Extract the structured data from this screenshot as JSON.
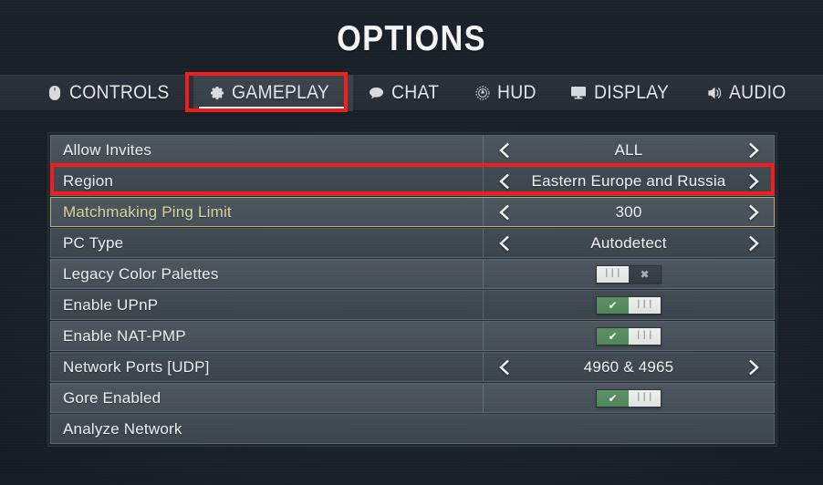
{
  "header": {
    "title": "OPTIONS"
  },
  "tabs": [
    {
      "id": "controls",
      "label": "CONTROLS",
      "icon": "mouse-icon",
      "active": false
    },
    {
      "id": "gameplay",
      "label": "GAMEPLAY",
      "icon": "gear-icon",
      "active": true
    },
    {
      "id": "chat",
      "label": "CHAT",
      "icon": "speech-bubble-icon",
      "active": false
    },
    {
      "id": "hud",
      "label": "HUD",
      "icon": "compass-icon",
      "active": false
    },
    {
      "id": "display",
      "label": "DISPLAY",
      "icon": "monitor-icon",
      "active": false
    },
    {
      "id": "audio",
      "label": "AUDIO",
      "icon": "speaker-icon",
      "active": false
    }
  ],
  "settings": [
    {
      "id": "allow-invites",
      "label": "Allow Invites",
      "type": "selector",
      "value": "ALL",
      "highlighted": false
    },
    {
      "id": "region",
      "label": "Region",
      "type": "selector",
      "value": "Eastern Europe and Russia",
      "highlighted": false
    },
    {
      "id": "matchmaking-ping-limit",
      "label": "Matchmaking Ping Limit",
      "type": "selector",
      "value": "300",
      "highlighted": true
    },
    {
      "id": "pc-type",
      "label": "PC Type",
      "type": "selector",
      "value": "Autodetect",
      "highlighted": false
    },
    {
      "id": "legacy-color-palettes",
      "label": "Legacy Color Palettes",
      "type": "toggle",
      "value": "off",
      "highlighted": false
    },
    {
      "id": "enable-upnp",
      "label": "Enable UPnP",
      "type": "toggle",
      "value": "on",
      "highlighted": false
    },
    {
      "id": "enable-nat-pmp",
      "label": "Enable NAT-PMP",
      "type": "toggle",
      "value": "on",
      "highlighted": false
    },
    {
      "id": "network-ports-udp",
      "label": "Network Ports [UDP]",
      "type": "selector",
      "value": "4960 & 4965",
      "highlighted": false
    },
    {
      "id": "gore-enabled",
      "label": "Gore Enabled",
      "type": "toggle",
      "value": "on",
      "highlighted": false
    },
    {
      "id": "analyze-network",
      "label": "Analyze Network",
      "type": "action",
      "value": "",
      "highlighted": false
    }
  ],
  "toggle_glyphs": {
    "on_mark": "✔",
    "off_mark": "✖",
    "grip": "|||"
  },
  "annotations": [
    {
      "id": "gameplay-tab-highlight",
      "color": "#f41d1d"
    },
    {
      "id": "region-row-highlight",
      "color": "#f41d1d"
    }
  ],
  "colors": {
    "accent_annotation": "#f41d1d",
    "toggle_on": "#52855c",
    "highlight_border": "#b5b268",
    "highlight_text": "#d8d79a",
    "tab_active_bg": "#3c444c",
    "row_bg": "#4d565e",
    "page_bg": "#161d24"
  }
}
